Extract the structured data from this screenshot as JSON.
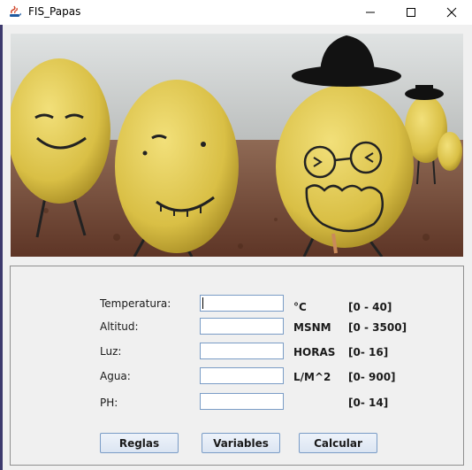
{
  "window": {
    "title": "FIS_Papas"
  },
  "form": {
    "rows": [
      {
        "label": "Temperatura:",
        "value": "",
        "unit": "°C",
        "range": "[0 - 40]"
      },
      {
        "label": "Altitud:",
        "value": "",
        "unit": "MSNM",
        "range": "[0 - 3500]"
      },
      {
        "label": "Luz:",
        "value": "",
        "unit": "HORAS",
        "range": "[0- 16]"
      },
      {
        "label": "Agua:",
        "value": "",
        "unit": "L/M^2",
        "range": "[0- 900]"
      },
      {
        "label": "PH:",
        "value": "",
        "unit": "",
        "range": "[0- 14]"
      }
    ]
  },
  "buttons": {
    "rules": "Reglas",
    "variables": "Variables",
    "calculate": "Calcular"
  },
  "colors": {
    "titlebar": "#ffffff",
    "panel": "#f0f0f0",
    "sky": "#c9ced0",
    "ground": "#7a4c35",
    "potato": "#e2cc55"
  }
}
